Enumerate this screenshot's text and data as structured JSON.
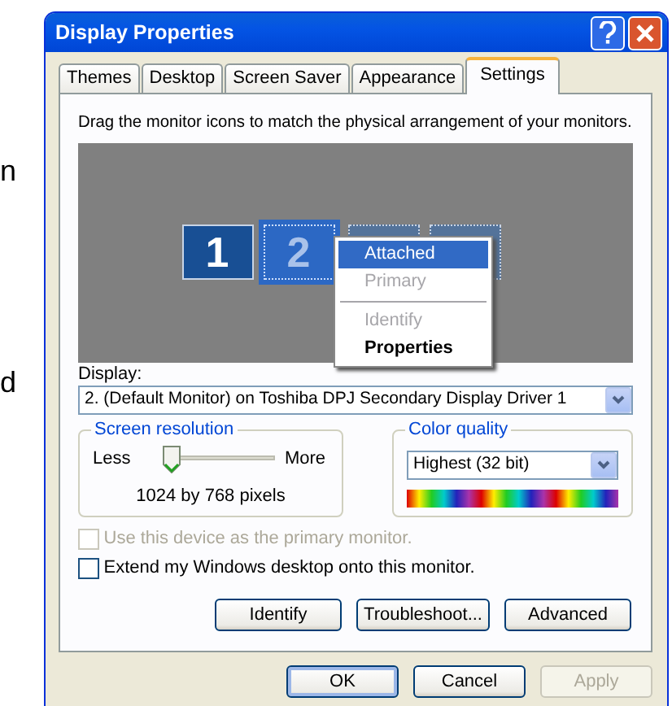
{
  "margin_fragments": [
    "n",
    "d"
  ],
  "window": {
    "title": "Display Properties"
  },
  "tabs": [
    {
      "label": "Themes",
      "selected": false
    },
    {
      "label": "Desktop",
      "selected": false
    },
    {
      "label": "Screen Saver",
      "selected": false
    },
    {
      "label": "Appearance",
      "selected": false
    },
    {
      "label": "Settings",
      "selected": true
    }
  ],
  "settings": {
    "instruction": "Drag the monitor icons to match the physical arrangement of your monitors.",
    "monitors": [
      {
        "label": "1",
        "attached": true,
        "selected": false
      },
      {
        "label": "2",
        "attached": false,
        "selected": true
      },
      {
        "attached": false,
        "selected": false
      },
      {
        "attached": false,
        "selected": false
      }
    ],
    "context_menu": [
      {
        "kind": "item",
        "label": "Attached",
        "selected": true,
        "disabled": false,
        "default": false
      },
      {
        "kind": "item",
        "label": "Primary",
        "selected": false,
        "disabled": true,
        "default": false
      },
      {
        "kind": "separator"
      },
      {
        "kind": "item",
        "label": "Identify",
        "selected": false,
        "disabled": true,
        "default": false
      },
      {
        "kind": "item",
        "label": "Properties",
        "selected": false,
        "disabled": false,
        "default": true
      }
    ],
    "display": {
      "label": "Display:",
      "value": "2. (Default Monitor) on Toshiba DPJ Secondary Display Driver 1"
    },
    "resolution": {
      "title": "Screen resolution",
      "less": "Less",
      "more": "More",
      "level": 0,
      "reading": "1024 by 768 pixels"
    },
    "color_quality": {
      "title": "Color quality",
      "value": "Highest (32 bit)"
    },
    "checkboxes": [
      {
        "label": "Use this device as the primary monitor.",
        "checked": false,
        "disabled": true
      },
      {
        "label": "Extend my Windows desktop onto this monitor.",
        "checked": false,
        "disabled": false
      }
    ],
    "buttons": [
      "Identify",
      "Troubleshoot...",
      "Advanced"
    ]
  },
  "dialog_buttons": [
    {
      "label": "OK",
      "disabled": false,
      "default": true
    },
    {
      "label": "Cancel",
      "disabled": false,
      "default": false
    },
    {
      "label": "Apply",
      "disabled": true,
      "default": false
    }
  ]
}
